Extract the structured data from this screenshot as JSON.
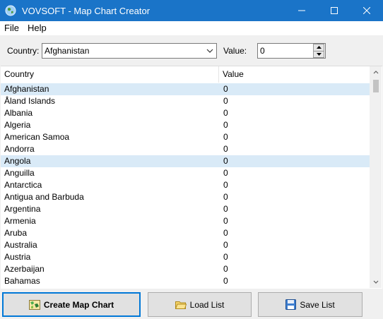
{
  "window": {
    "title": "VOVSOFT - Map Chart Creator",
    "minimize_glyph": "—",
    "maximize_glyph": "☐",
    "close_glyph": "✕",
    "app_icon": "globe-icon"
  },
  "menu": [
    "File",
    "Help"
  ],
  "toolbar": {
    "country_label": "Country:",
    "country_value": "Afghanistan",
    "value_label": "Value:",
    "value_value": "0"
  },
  "table": {
    "columns": [
      "Country",
      "Value"
    ],
    "rows": [
      {
        "country": "Afghanistan",
        "value": "0"
      },
      {
        "country": "Åland Islands",
        "value": "0"
      },
      {
        "country": "Albania",
        "value": "0"
      },
      {
        "country": "Algeria",
        "value": "0"
      },
      {
        "country": "American Samoa",
        "value": "0"
      },
      {
        "country": "Andorra",
        "value": "0"
      },
      {
        "country": "Angola",
        "value": "0"
      },
      {
        "country": "Anguilla",
        "value": "0"
      },
      {
        "country": "Antarctica",
        "value": "0"
      },
      {
        "country": "Antigua and Barbuda",
        "value": "0"
      },
      {
        "country": "Argentina",
        "value": "0"
      },
      {
        "country": "Armenia",
        "value": "0"
      },
      {
        "country": "Aruba",
        "value": "0"
      },
      {
        "country": "Australia",
        "value": "0"
      },
      {
        "country": "Austria",
        "value": "0"
      },
      {
        "country": "Azerbaijan",
        "value": "0"
      },
      {
        "country": "Bahamas",
        "value": "0"
      }
    ],
    "highlighted_rows": [
      "Afghanistan",
      "Angola"
    ]
  },
  "buttons": {
    "create": "Create Map Chart",
    "load": "Load List",
    "save": "Save List"
  },
  "colors": {
    "titlebar": "#1a74c8",
    "selection": "#d9eaf7",
    "accent": "#0078d7"
  }
}
